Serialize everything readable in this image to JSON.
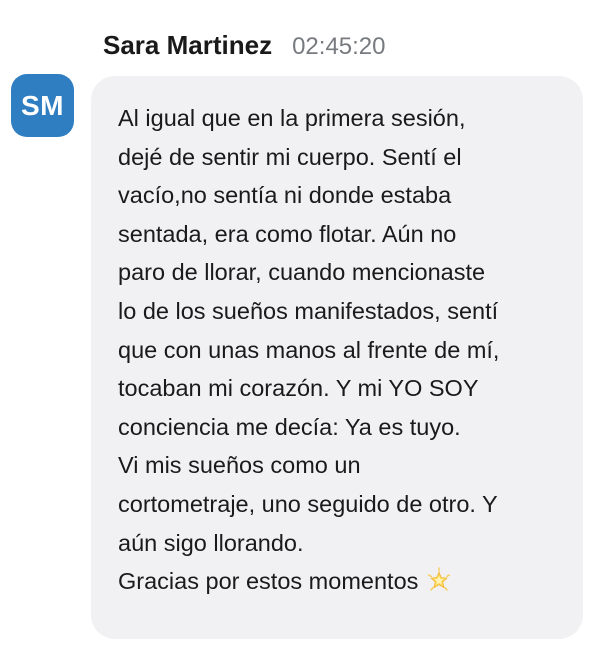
{
  "message": {
    "avatar_initials": "SM",
    "sender_name": "Sara Martinez",
    "timestamp": "02:45:20",
    "lines": [
      "Al igual que en la primera sesión,",
      "dejé de sentir mi cuerpo. Sentí el",
      "vacío,no sentía ni donde estaba",
      "sentada, era como flotar. Aún no",
      "paro de llorar, cuando mencionaste",
      "lo de los sueños manifestados, sentí",
      "que con unas manos al frente de mí,",
      "tocaban mi corazón. Y mi YO SOY",
      "conciencia me decía: Ya es tuyo.",
      "Vi mis sueños como un",
      "cortometraje, uno seguido de otro. Y",
      "aún sigo llorando.",
      "Gracias por estos momentos"
    ],
    "trailing_emoji": "glowing-star-icon"
  },
  "colors": {
    "avatar_bg": "#2f7ec2",
    "bubble_bg": "#f1f1f4",
    "timestamp": "#777b80",
    "text": "#1a1a1a"
  }
}
